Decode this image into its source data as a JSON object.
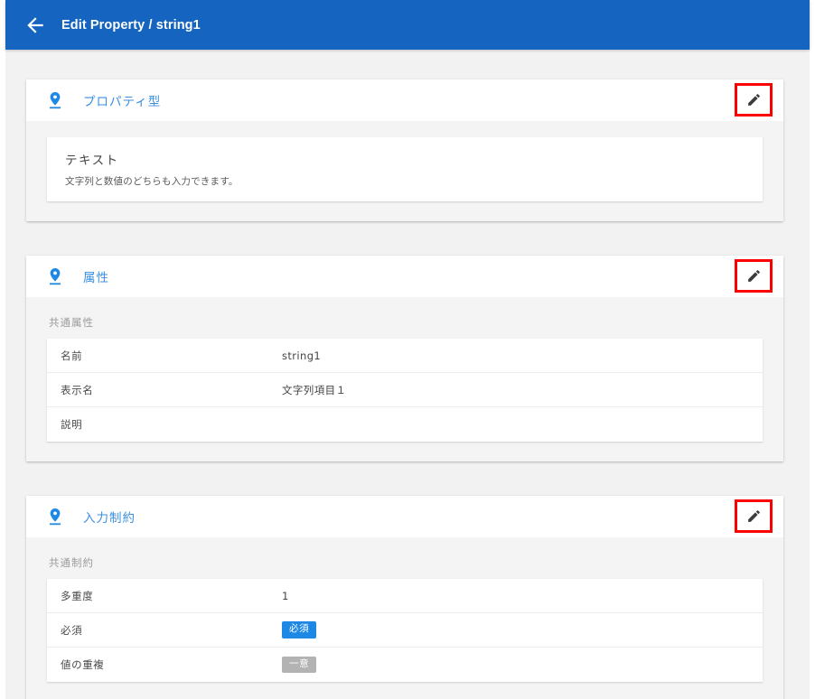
{
  "appbar": {
    "back_icon": "arrow-left-icon",
    "title": "Edit Property / string1",
    "background": "#1565c0"
  },
  "theme": {
    "accent": "#1e88e5",
    "title_color": "#3b8fe0",
    "page_background": "#f2f2f2",
    "highlight_border": "#fa0000",
    "badge_blue": "#1e88e5",
    "badge_grey": "#b3b3b3"
  },
  "cards": [
    {
      "icon": "place-pin-icon",
      "title": "プロパティ型",
      "edit_icon": "pencil-icon",
      "edit_highlighted": true,
      "type_panel": {
        "name": "テキスト",
        "description": "文字列と数値のどちらも入力できます。"
      }
    },
    {
      "icon": "place-pin-icon",
      "title": "属性",
      "edit_icon": "pencil-icon",
      "edit_highlighted": true,
      "section_label": "共通属性",
      "rows": [
        {
          "label": "名前",
          "value": "string1"
        },
        {
          "label": "表示名",
          "value": "文字列項目１"
        },
        {
          "label": "説明",
          "value": ""
        }
      ]
    },
    {
      "icon": "place-pin-icon",
      "title": "入力制約",
      "edit_icon": "pencil-icon",
      "edit_highlighted": true,
      "section_label": "共通制約",
      "rows": [
        {
          "label": "多重度",
          "value": "1"
        },
        {
          "label": "必須",
          "badge": {
            "text": "必須",
            "style": "blue"
          }
        },
        {
          "label": "値の重複",
          "badge": {
            "text": "一意",
            "style": "grey"
          }
        }
      ]
    }
  ]
}
